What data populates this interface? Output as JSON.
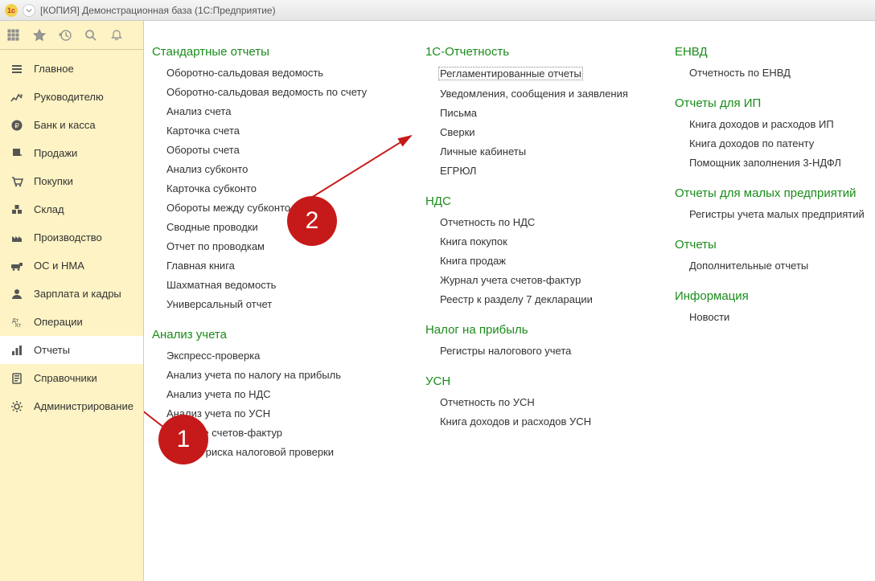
{
  "window": {
    "title": "[КОПИЯ] Демонстрационная база  (1С:Предприятие)"
  },
  "sidebar": {
    "items": [
      {
        "id": "main",
        "label": "Главное"
      },
      {
        "id": "manager",
        "label": "Руководителю"
      },
      {
        "id": "bank",
        "label": "Банк и касса"
      },
      {
        "id": "sales",
        "label": "Продажи"
      },
      {
        "id": "purchases",
        "label": "Покупки"
      },
      {
        "id": "stock",
        "label": "Склад"
      },
      {
        "id": "production",
        "label": "Производство"
      },
      {
        "id": "os",
        "label": "ОС и НМА"
      },
      {
        "id": "salary",
        "label": "Зарплата и кадры"
      },
      {
        "id": "operations",
        "label": "Операции"
      },
      {
        "id": "reports",
        "label": "Отчеты"
      },
      {
        "id": "refs",
        "label": "Справочники"
      },
      {
        "id": "admin",
        "label": "Администрирование"
      }
    ],
    "active_id": "reports"
  },
  "columns": [
    {
      "sections": [
        {
          "title": "Стандартные отчеты",
          "items": [
            "Оборотно-сальдовая ведомость",
            "Оборотно-сальдовая ведомость по счету",
            "Анализ счета",
            "Карточка счета",
            "Обороты счета",
            "Анализ субконто",
            "Карточка субконто",
            "Обороты между субконто",
            "Сводные проводки",
            "Отчет по проводкам",
            "Главная книга",
            "Шахматная ведомость",
            "Универсальный отчет"
          ]
        },
        {
          "title": "Анализ учета",
          "items": [
            "Экспресс-проверка",
            "Анализ учета по налогу на прибыль",
            "Анализ учета по НДС",
            "Анализ учета по УСН",
            "Наличие счетов-фактур",
            "Оценка риска налоговой проверки"
          ]
        }
      ]
    },
    {
      "sections": [
        {
          "title": "1С-Отчетность",
          "items": [
            "Регламентированные отчеты",
            "Уведомления, сообщения и заявления",
            "Письма",
            "Сверки",
            "Личные кабинеты",
            "ЕГРЮЛ"
          ],
          "highlight_index": 0
        },
        {
          "title": "НДС",
          "items": [
            "Отчетность по НДС",
            "Книга покупок",
            "Книга продаж",
            "Журнал учета счетов-фактур",
            "Реестр к разделу 7 декларации"
          ]
        },
        {
          "title": "Налог на прибыль",
          "items": [
            "Регистры налогового учета"
          ]
        },
        {
          "title": "УСН",
          "items": [
            "Отчетность по УСН",
            "Книга доходов и расходов УСН"
          ]
        }
      ]
    },
    {
      "sections": [
        {
          "title": "ЕНВД",
          "items": [
            "Отчетность по ЕНВД"
          ]
        },
        {
          "title": "Отчеты для ИП",
          "items": [
            "Книга доходов и расходов ИП",
            "Книга доходов по патенту",
            "Помощник заполнения 3-НДФЛ"
          ]
        },
        {
          "title": "Отчеты для малых предприятий",
          "items": [
            "Регистры учета малых предприятий"
          ]
        },
        {
          "title": "Отчеты",
          "items": [
            "Дополнительные отчеты"
          ]
        },
        {
          "title": "Информация",
          "items": [
            "Новости"
          ]
        }
      ]
    }
  ],
  "annotations": {
    "badge1": "1",
    "badge2": "2"
  }
}
